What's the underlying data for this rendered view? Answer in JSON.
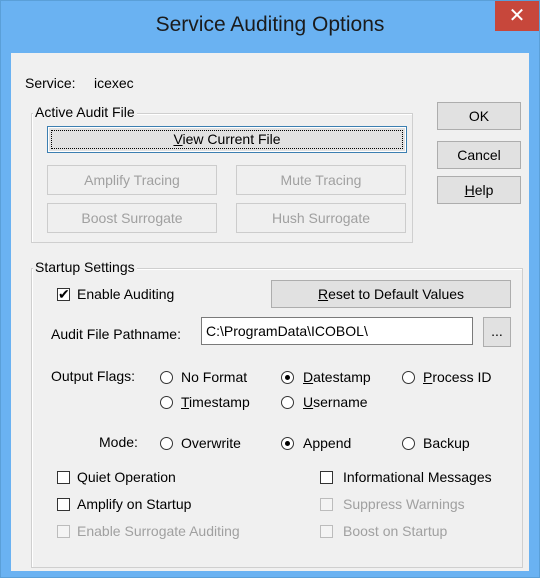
{
  "window": {
    "title": "Service Auditing Options",
    "close_glyph": "✕"
  },
  "service": {
    "label": "Service:",
    "value": "icexec"
  },
  "audit_file_group": {
    "legend": "Active Audit File",
    "view_current_file": {
      "hot": "V",
      "rest": "iew Current File"
    },
    "amplify_tracing": "Amplify Tracing",
    "mute_tracing": "Mute Tracing",
    "boost_surrogate": "Boost Surrogate",
    "hush_surrogate": "Hush Surrogate"
  },
  "side_buttons": {
    "ok": "OK",
    "cancel": "Cancel",
    "help": {
      "hot": "H",
      "rest": "elp"
    }
  },
  "startup": {
    "legend": "Startup Settings",
    "enable_auditing": {
      "label": "Enable Auditing",
      "checked": true
    },
    "reset_button": {
      "hot": "R",
      "rest": "eset to Default Values"
    },
    "audit_path_label": "Audit File Pathname:",
    "audit_path_value": "C:\\ProgramData\\ICOBOL\\",
    "browse_label": "...",
    "output_flags_label": "Output Flags:",
    "flags": {
      "no_format": {
        "label": "No Format",
        "checked": false
      },
      "datestamp": {
        "hot": "D",
        "rest": "atestamp",
        "checked": true
      },
      "process_id": {
        "hot": "P",
        "rest": "rocess ID",
        "checked": false
      },
      "timestamp": {
        "hot": "T",
        "rest": "imestamp",
        "checked": false
      },
      "username": {
        "hot": "U",
        "rest": "sername",
        "checked": false
      }
    },
    "mode_label": "Mode:",
    "modes": {
      "overwrite": {
        "label": "Overwrite",
        "checked": false
      },
      "append": {
        "label": "Append",
        "checked": true
      },
      "backup": {
        "label": "Backup",
        "checked": false
      }
    },
    "options": {
      "quiet_operation": {
        "label": "Quiet Operation",
        "checked": false
      },
      "amplify_on_startup": {
        "label": "Amplify on Startup",
        "checked": false
      },
      "enable_surrogate_auditing": {
        "label": "Enable Surrogate Auditing",
        "checked": false
      },
      "informational_messages": {
        "label": "Informational Messages",
        "checked": false
      },
      "suppress_warnings": {
        "label": "Suppress Warnings",
        "checked": false
      },
      "boost_on_startup": {
        "label": "Boost on Startup",
        "checked": false
      }
    }
  },
  "icons": {
    "close": "close-icon",
    "check": "checkmark-icon"
  },
  "colors": {
    "title_bar": "#6ab2f2",
    "close_button": "#c7473b",
    "dialog_bg": "#f0f0f0",
    "disabled_text": "#a0a0a0"
  }
}
